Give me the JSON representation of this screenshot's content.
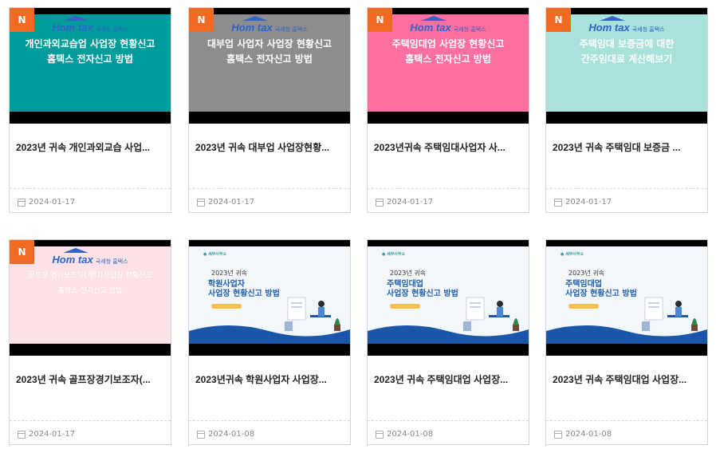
{
  "cards": [
    {
      "badge": "N",
      "title": "2023년 귀속 개인과외교습 사업...",
      "date": "2024-01-17",
      "thumb": {
        "style": "hometax",
        "bg": "#009b9b",
        "text": "개인과외교습업 사업장 현황신고\n홈택스 전자신고 방법",
        "textColor": "#ffffff"
      }
    },
    {
      "badge": "N",
      "title": "2023년 귀속 대부업 사업장현황...",
      "date": "2024-01-17",
      "thumb": {
        "style": "hometax",
        "bg": "#8d8d8d",
        "text": "대부업 사업자 사업장 현황신고\n홈택스 전자신고 방법",
        "textColor": "#ffffff"
      }
    },
    {
      "badge": "N",
      "title": "2023년귀속 주택임대사업자 사...",
      "date": "2024-01-17",
      "thumb": {
        "style": "hometax",
        "bg": "#ff6fa0",
        "text": "주택임대업 사업장 현황신고\n홈택스 전자신고 방법",
        "textColor": "#ffffff"
      }
    },
    {
      "badge": "N",
      "title": "2023년 귀속 주택임대 보증금 ...",
      "date": "2024-01-17",
      "thumb": {
        "style": "hometax",
        "bg": "#a8e2db",
        "text": "주택임대 보증금에 대한\n간주임대료 계산해보기",
        "textColor": "#ffffff"
      }
    },
    {
      "badge": "N",
      "title": "2023년 귀속 골프장경기보조자(...",
      "date": "2024-01-17",
      "thumb": {
        "style": "hometax",
        "bg": "#fde3e8",
        "text": "골프장 경기보조자(캐디)사업장 현황신고\n홈택스 전자신고 방법",
        "textColor": "#ffffff"
      }
    },
    {
      "badge": "",
      "title": "2023년귀속 학원사업자 사업장...",
      "date": "2024-01-08",
      "thumb": {
        "style": "illustration",
        "year": "2023년 귀속",
        "line1": "학원사업자",
        "line2": "사업장 현황신고 방법"
      }
    },
    {
      "badge": "",
      "title": "2023년 귀속 주택임대업 사업장...",
      "date": "2024-01-08",
      "thumb": {
        "style": "illustration",
        "year": "2023년 귀속",
        "line1": "주택임대업",
        "line2": "사업장 현황신고 방법"
      }
    },
    {
      "badge": "",
      "title": "2023년 귀속 주택임대업 사업장...",
      "date": "2024-01-08",
      "thumb": {
        "style": "illustration",
        "year": "2023년 귀속",
        "line1": "주택임대업",
        "line2": "사업장 현황신고 방법"
      }
    }
  ],
  "logo": {
    "brand": "Hom tax",
    "sub": "국세청 홈택스"
  },
  "colors": {
    "badge": "#f06a22",
    "border": "#d6d6d6",
    "wave": "#1a57a8"
  }
}
